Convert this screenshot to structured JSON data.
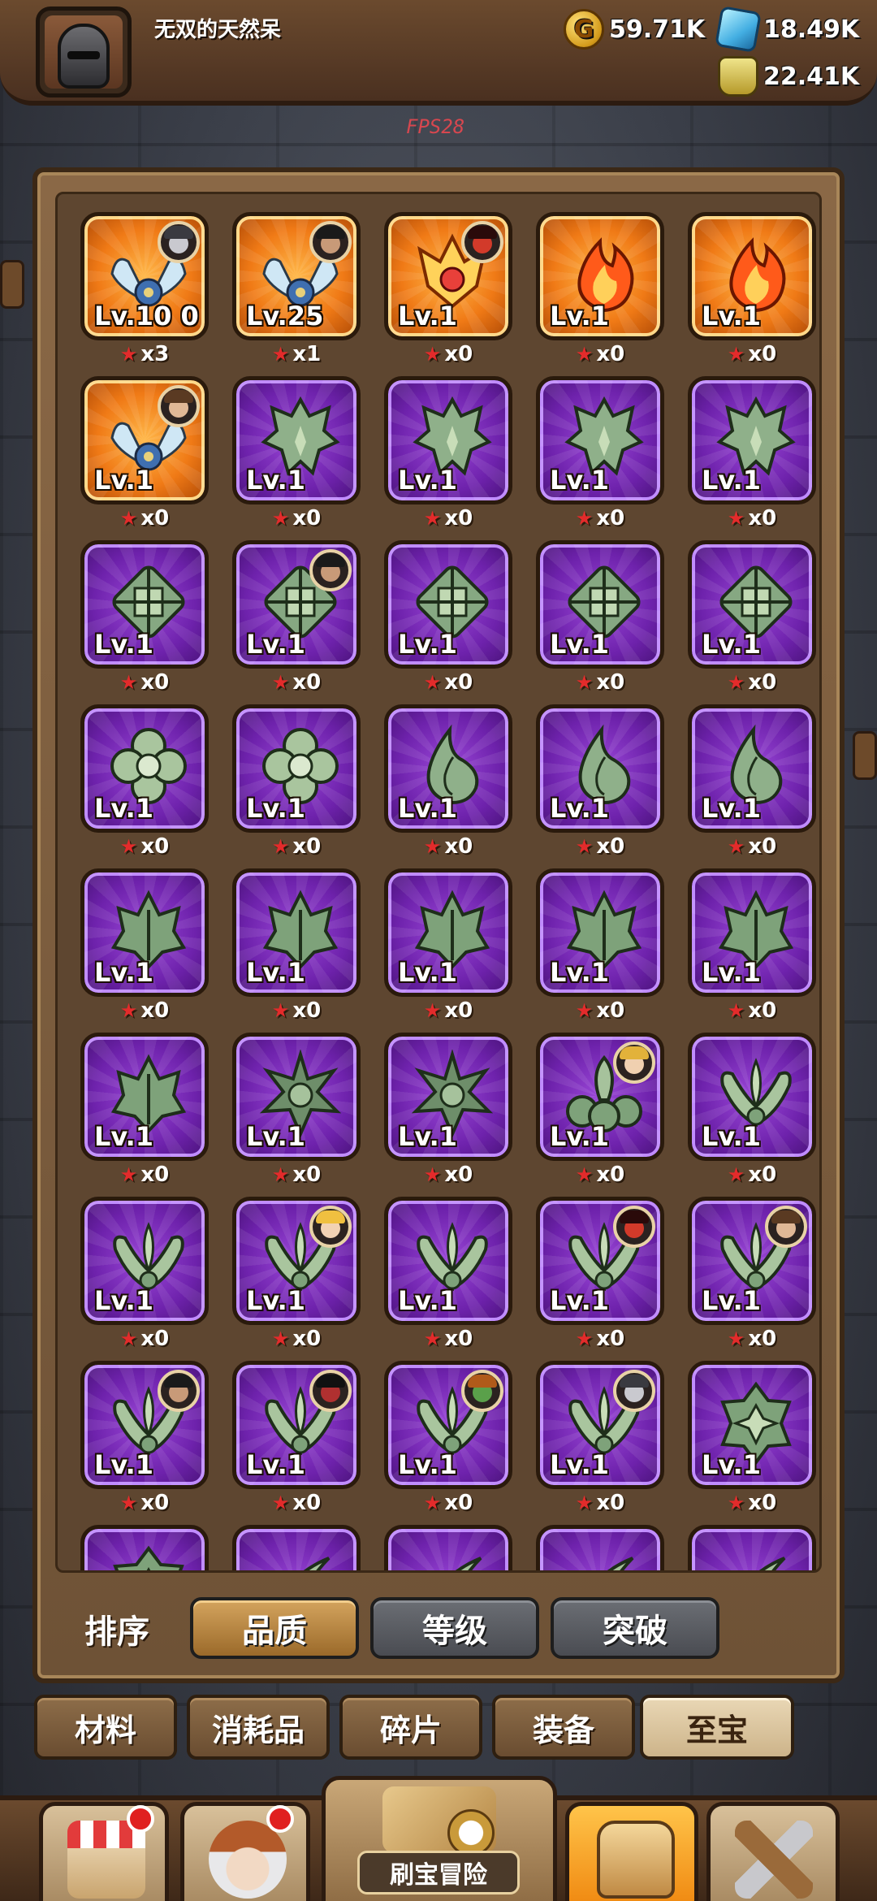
{
  "header": {
    "player_name": "无双的天然呆",
    "gold": "59.71K",
    "gems": "18.49K",
    "potion": "22.41K",
    "fps": "FPS28"
  },
  "items": [
    {
      "rarity": "orange",
      "art": "wings",
      "level": "Lv.10 0",
      "stars": "x3",
      "hero": "knight"
    },
    {
      "rarity": "orange",
      "art": "wings",
      "level": "Lv.25",
      "stars": "x1",
      "hero": "dark"
    },
    {
      "rarity": "orange",
      "art": "flame-crown",
      "level": "Lv.1",
      "stars": "x0",
      "hero": "red"
    },
    {
      "rarity": "orange",
      "art": "flame",
      "level": "Lv.1",
      "stars": "x0",
      "hero": ""
    },
    {
      "rarity": "orange",
      "art": "flame",
      "level": "Lv.1",
      "stars": "x0",
      "hero": ""
    },
    {
      "rarity": "orange",
      "art": "wings",
      "level": "Lv.1",
      "stars": "x0",
      "hero": "bearded"
    },
    {
      "rarity": "purple",
      "art": "dragon",
      "level": "Lv.1",
      "stars": "x0",
      "hero": ""
    },
    {
      "rarity": "purple",
      "art": "dragon",
      "level": "Lv.1",
      "stars": "x0",
      "hero": ""
    },
    {
      "rarity": "purple",
      "art": "dragon",
      "level": "Lv.1",
      "stars": "x0",
      "hero": ""
    },
    {
      "rarity": "purple",
      "art": "dragon",
      "level": "Lv.1",
      "stars": "x0",
      "hero": ""
    },
    {
      "rarity": "purple",
      "art": "knot",
      "level": "Lv.1",
      "stars": "x0",
      "hero": ""
    },
    {
      "rarity": "purple",
      "art": "knot",
      "level": "Lv.1",
      "stars": "x0",
      "hero": "dark"
    },
    {
      "rarity": "purple",
      "art": "knot",
      "level": "Lv.1",
      "stars": "x0",
      "hero": ""
    },
    {
      "rarity": "purple",
      "art": "knot",
      "level": "Lv.1",
      "stars": "x0",
      "hero": ""
    },
    {
      "rarity": "purple",
      "art": "knot",
      "level": "Lv.1",
      "stars": "x0",
      "hero": ""
    },
    {
      "rarity": "purple",
      "art": "flower",
      "level": "Lv.1",
      "stars": "x0",
      "hero": ""
    },
    {
      "rarity": "purple",
      "art": "flower",
      "level": "Lv.1",
      "stars": "x0",
      "hero": ""
    },
    {
      "rarity": "purple",
      "art": "leaf-flame",
      "level": "Lv.1",
      "stars": "x0",
      "hero": ""
    },
    {
      "rarity": "purple",
      "art": "leaf-flame",
      "level": "Lv.1",
      "stars": "x0",
      "hero": ""
    },
    {
      "rarity": "purple",
      "art": "leaf-flame",
      "level": "Lv.1",
      "stars": "x0",
      "hero": ""
    },
    {
      "rarity": "purple",
      "art": "horned",
      "level": "Lv.1",
      "stars": "x0",
      "hero": ""
    },
    {
      "rarity": "purple",
      "art": "horned",
      "level": "Lv.1",
      "stars": "x0",
      "hero": ""
    },
    {
      "rarity": "purple",
      "art": "horned",
      "level": "Lv.1",
      "stars": "x0",
      "hero": ""
    },
    {
      "rarity": "purple",
      "art": "horned",
      "level": "Lv.1",
      "stars": "x0",
      "hero": ""
    },
    {
      "rarity": "purple",
      "art": "horned",
      "level": "Lv.1",
      "stars": "x0",
      "hero": ""
    },
    {
      "rarity": "purple",
      "art": "horned",
      "level": "Lv.1",
      "stars": "x0",
      "hero": ""
    },
    {
      "rarity": "purple",
      "art": "spiked",
      "level": "Lv.1",
      "stars": "x0",
      "hero": ""
    },
    {
      "rarity": "purple",
      "art": "spiked",
      "level": "Lv.1",
      "stars": "x0",
      "hero": ""
    },
    {
      "rarity": "purple",
      "art": "clover",
      "level": "Lv.1",
      "stars": "x0",
      "hero": "king"
    },
    {
      "rarity": "purple",
      "art": "leaf-wings",
      "level": "Lv.1",
      "stars": "x0",
      "hero": ""
    },
    {
      "rarity": "purple",
      "art": "leaf-wings",
      "level": "Lv.1",
      "stars": "x0",
      "hero": ""
    },
    {
      "rarity": "purple",
      "art": "leaf-wings",
      "level": "Lv.1",
      "stars": "x0",
      "hero": "blonde"
    },
    {
      "rarity": "purple",
      "art": "leaf-wings",
      "level": "Lv.1",
      "stars": "x0",
      "hero": ""
    },
    {
      "rarity": "purple",
      "art": "leaf-wings",
      "level": "Lv.1",
      "stars": "x0",
      "hero": "red"
    },
    {
      "rarity": "purple",
      "art": "leaf-wings",
      "level": "Lv.1",
      "stars": "x0",
      "hero": "bearded"
    },
    {
      "rarity": "purple",
      "art": "leaf-wings",
      "level": "Lv.1",
      "stars": "x0",
      "hero": "dark"
    },
    {
      "rarity": "purple",
      "art": "leaf-wings",
      "level": "Lv.1",
      "stars": "x0",
      "hero": "masked"
    },
    {
      "rarity": "purple",
      "art": "leaf-wings",
      "level": "Lv.1",
      "stars": "x0",
      "hero": "orc"
    },
    {
      "rarity": "purple",
      "art": "leaf-wings",
      "level": "Lv.1",
      "stars": "x0",
      "hero": "knight"
    },
    {
      "rarity": "purple",
      "art": "star-gem",
      "level": "Lv.1",
      "stars": "x0",
      "hero": ""
    },
    {
      "rarity": "purple",
      "art": "star-gem",
      "level": "",
      "stars": "",
      "hero": ""
    },
    {
      "rarity": "purple",
      "art": "claw",
      "level": "",
      "stars": "",
      "hero": ""
    },
    {
      "rarity": "purple",
      "art": "claw",
      "level": "",
      "stars": "",
      "hero": ""
    },
    {
      "rarity": "purple",
      "art": "claw",
      "level": "",
      "stars": "",
      "hero": ""
    },
    {
      "rarity": "purple",
      "art": "claw",
      "level": "",
      "stars": "",
      "hero": ""
    }
  ],
  "sort": {
    "label": "排序",
    "buttons": [
      {
        "label": "品质",
        "active": true
      },
      {
        "label": "等级",
        "active": false
      },
      {
        "label": "突破",
        "active": false
      }
    ]
  },
  "categories": [
    {
      "label": "材料",
      "active": false
    },
    {
      "label": "消耗品",
      "active": false
    },
    {
      "label": "碎片",
      "active": false
    },
    {
      "label": "装备",
      "active": false
    },
    {
      "label": "至宝",
      "active": true
    }
  ],
  "bottom_nav": {
    "adventure_label": "刷宝冒险",
    "buttons": [
      {
        "name": "shop",
        "badge": true
      },
      {
        "name": "heroes",
        "badge": true
      },
      {
        "name": "adventure",
        "badge": false
      },
      {
        "name": "bag",
        "badge": false,
        "active": true
      },
      {
        "name": "forge",
        "badge": false
      }
    ]
  },
  "colors": {
    "orange_tile": "#f07a16",
    "purple_tile": "#6e22ac",
    "star": "#e32b2b",
    "active_sort": "#b8843f"
  }
}
